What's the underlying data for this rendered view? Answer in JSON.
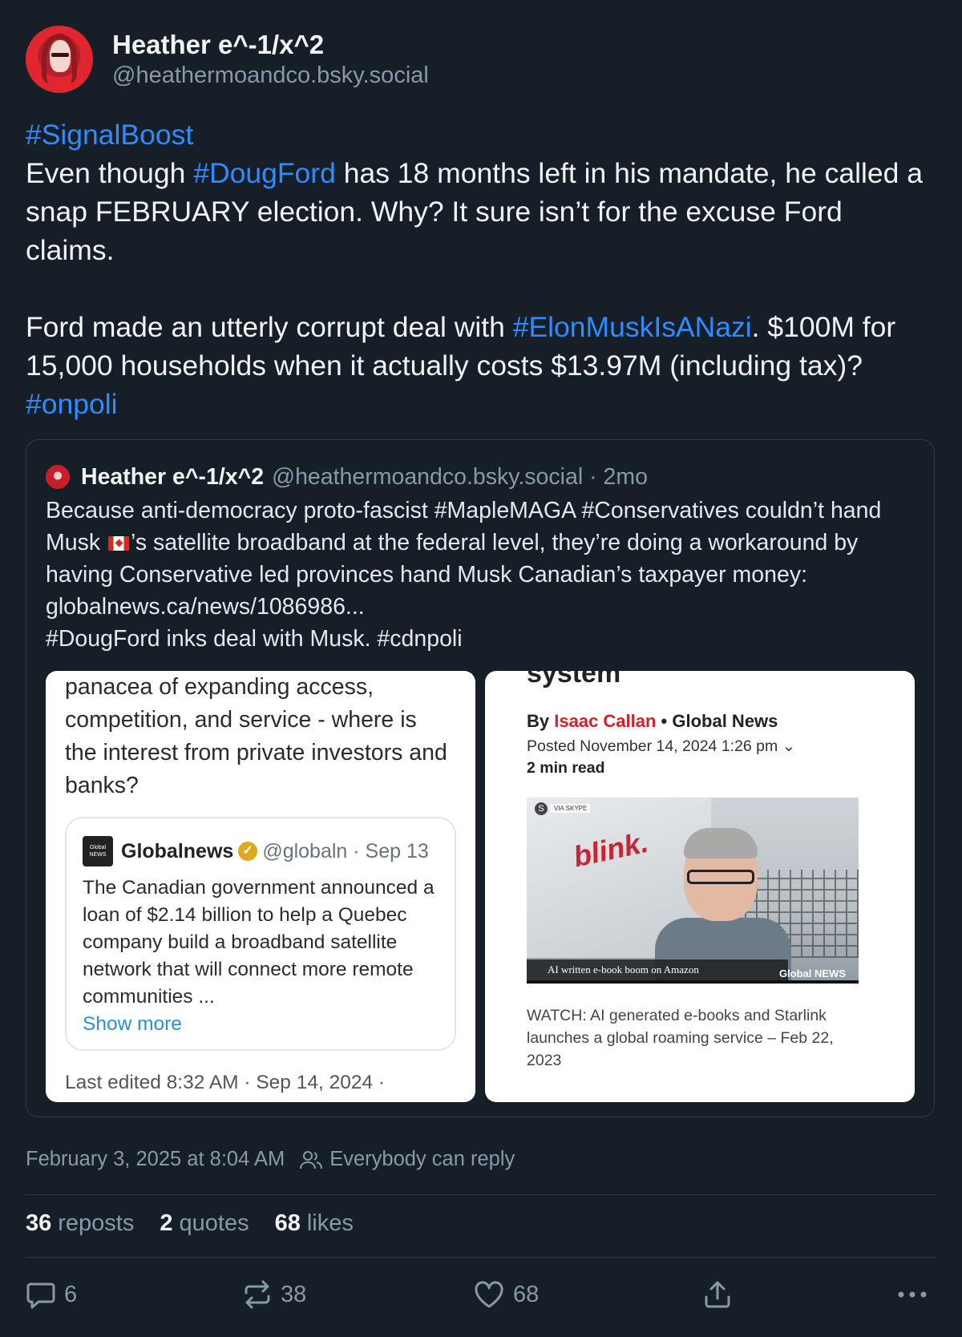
{
  "author": {
    "name": "Heather e^-1/x^2",
    "handle": "@heathermoandco.bsky.social"
  },
  "post": {
    "line1_tag": "#SignalBoost",
    "p1_a": "Even though ",
    "p1_tag": "#DougFord",
    "p1_b": " has 18 months left in his mandate, he called a snap FEBRUARY election. Why? It sure isn’t for the excuse Ford claims.",
    "p2_a": "Ford made an utterly corrupt deal with ",
    "p2_tag": "#ElonMuskIsANazi",
    "p2_b": ". $100M for 15,000 households when it actually costs $13.97M (including tax)? ",
    "p2_tag2": "#onpoli"
  },
  "quote": {
    "name": "Heather e^-1/x^2",
    "handle": "@heathermoandco.bsky.social · 2mo",
    "text_a": "Because anti-democracy proto-fascist #MapleMAGA #Conservatives couldn’t hand Musk ",
    "text_b": "’s satellite broadband at the federal level, they’re doing a workaround by having Conservative led provinces hand Musk Canadian’s taxpayer money: globalnews.ca/news/1086986...",
    "text_c": "#DougFord inks deal with Musk. #cdnpoli",
    "left_image": {
      "text": "panacea of expanding access, competition, and service - where is the interest from private investors and banks?",
      "tweet_logo": "Global NEWS",
      "tweet_name": "Globalnews",
      "tweet_handle": "@globaln · Sep 13",
      "tweet_body": "The Canadian government announced a loan of $2.14 billion to help a Quebec company build a broadband satellite network that will connect more remote communities ...",
      "show_more": "Show more",
      "edited": "Last edited 8:32 AM · Sep 14, 2024 ·"
    },
    "right_image": {
      "title": "system",
      "by_prefix": "By ",
      "author": "Isaac Callan",
      "outlet": " • Global News",
      "posted": "Posted November 14, 2024 1:26 pm",
      "read": "2 min read",
      "via": "VIA SKYPE",
      "sign": "blink.",
      "lower_third": "AI written e-book boom on Amazon",
      "logo": "Global NEWS",
      "caption": "WATCH: AI generated e-books and Starlink launches a global roaming service – Feb 22, 2023"
    }
  },
  "meta": {
    "timestamp": "February 3, 2025 at 8:04 AM",
    "reply_setting": "Everybody can reply"
  },
  "stats": {
    "reposts_n": "36",
    "reposts_label": "reposts",
    "quotes_n": "2",
    "quotes_label": "quotes",
    "likes_n": "68",
    "likes_label": "likes"
  },
  "actions": {
    "reply_count": "6",
    "repost_count": "38",
    "like_count": "68"
  },
  "colors": {
    "background": "#161e27",
    "link": "#2f8cff",
    "muted": "#8899a8"
  }
}
